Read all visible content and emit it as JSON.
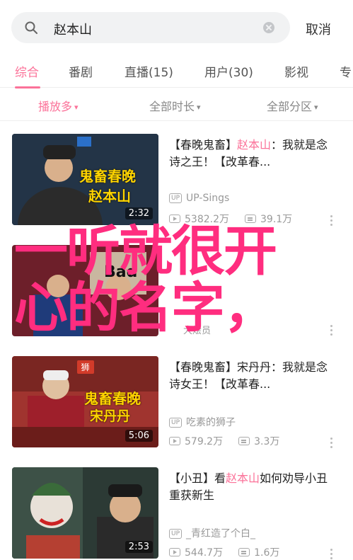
{
  "search": {
    "query": "赵本山",
    "cancel_label": "取消"
  },
  "tabs": [
    {
      "label": "综合"
    },
    {
      "label": "番剧"
    },
    {
      "label": "直播(15)"
    },
    {
      "label": "用户(30)"
    },
    {
      "label": "影视"
    },
    {
      "label": "专"
    }
  ],
  "filters": [
    {
      "label": "播放多"
    },
    {
      "label": "全部时长"
    },
    {
      "label": "全部分区"
    }
  ],
  "results": [
    {
      "title_prefix": "【春晚鬼畜】",
      "title_highlight": "赵本山",
      "title_suffix": "：我就是念诗之王！【改革春...",
      "uploader": "UP-Sings",
      "views": "5382.2万",
      "danmaku": "39.1万",
      "duration": "2:32",
      "thumb_banner": "",
      "thumb_caption_1": "鬼畜春晚",
      "thumb_caption_2": "赵本山"
    },
    {
      "title_prefix": "",
      "title_highlight": "",
      "title_suffix": "",
      "uploader": "大烩员",
      "views": "",
      "danmaku": "",
      "duration": "",
      "thumb_banner": "",
      "thumb_caption_1": "Bad",
      "thumb_caption_2": ""
    },
    {
      "title_prefix": "【春晚鬼畜】",
      "title_highlight": "",
      "title_suffix": "宋丹丹：我就是念诗女王！【改革春...",
      "uploader": "吃素的狮子",
      "views": "579.2万",
      "danmaku": "3.3万",
      "duration": "5:06",
      "thumb_banner": "狮",
      "thumb_caption_1": "鬼畜春晚",
      "thumb_caption_2": "宋丹丹"
    },
    {
      "title_prefix": "【小丑】看",
      "title_highlight": "赵本山",
      "title_suffix": "如何劝导小丑重获新生",
      "uploader": "_青红造了个白_",
      "views": "544.7万",
      "danmaku": "1.6万",
      "duration": "2:53",
      "thumb_banner": "",
      "thumb_caption_1": "",
      "thumb_caption_2": ""
    }
  ],
  "watermark": {
    "line1": "一听就很开",
    "line2": "心的名字，"
  },
  "colors": {
    "accent": "#fb7299",
    "watermark": "#ff2d7f"
  }
}
